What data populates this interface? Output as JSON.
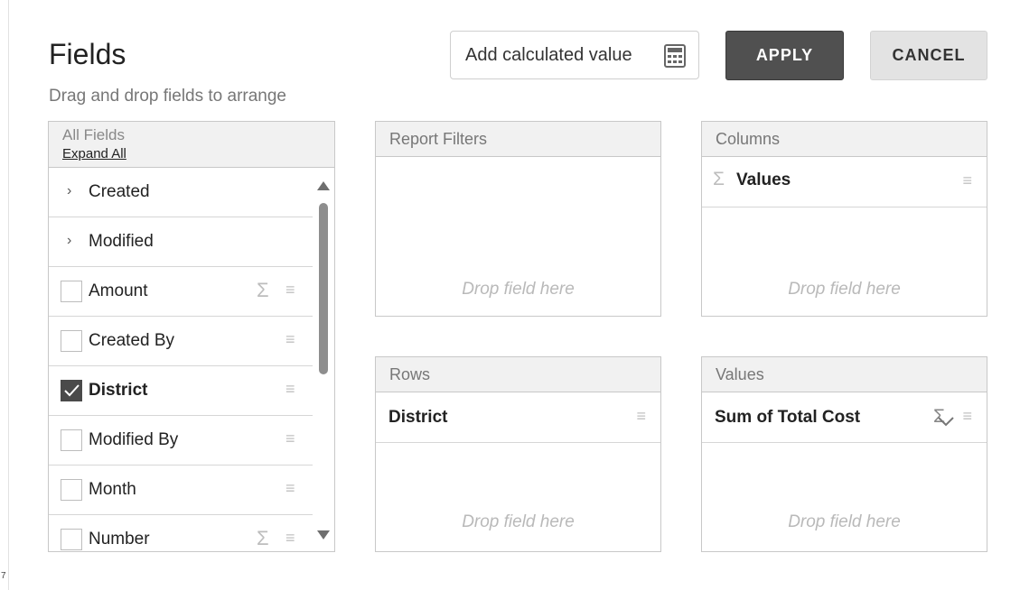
{
  "header": {
    "title": "Fields",
    "subtitle": "Drag and drop fields to arrange",
    "calc_button_label": "Add calculated value",
    "apply_label": "APPLY",
    "cancel_label": "CANCEL"
  },
  "all_fields": {
    "header_label": "All Fields",
    "expand_all_label": "Expand All",
    "folders": [
      {
        "label": "Created",
        "icon": "chevron-right-icon"
      },
      {
        "label": "Modified",
        "icon": "chevron-right-icon"
      }
    ],
    "fields": [
      {
        "label": "Amount",
        "checked": false,
        "sigma": "Σ"
      },
      {
        "label": "Created By",
        "checked": false,
        "sigma": ""
      },
      {
        "label": "District",
        "checked": true,
        "sigma": ""
      },
      {
        "label": "Modified By",
        "checked": false,
        "sigma": ""
      },
      {
        "label": "Month",
        "checked": false,
        "sigma": ""
      },
      {
        "label": "Number",
        "checked": false,
        "sigma": "Σ"
      }
    ]
  },
  "areas": {
    "report_filters": {
      "label": "Report Filters",
      "drop_hint": "Drop field here"
    },
    "columns": {
      "label": "Columns",
      "item": "Values",
      "drop_hint": "Drop field here"
    },
    "rows": {
      "label": "Rows",
      "item": "District",
      "drop_hint": "Drop field here"
    },
    "values": {
      "label": "Values",
      "item": "Sum of Total Cost",
      "drop_hint": "Drop field here"
    }
  },
  "corner_mark": "7",
  "icons": {
    "sigma": "Σ",
    "drag_handle": "≡",
    "chevron_right": "›"
  },
  "colors": {
    "apply_bg": "#505050",
    "cancel_bg": "#e3e3e3",
    "panel_header_bg": "#f1f1f1"
  }
}
